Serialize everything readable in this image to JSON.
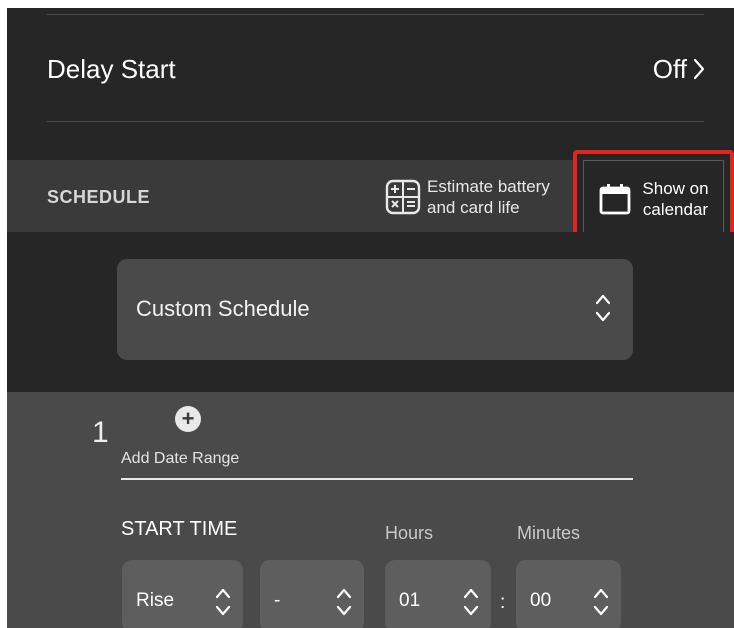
{
  "delay_start": {
    "label": "Delay Start",
    "value": "Off"
  },
  "schedule": {
    "section_title": "SCHEDULE",
    "estimate_label": "Estimate battery\nand card life",
    "calendar_label": "Show on\ncalendar",
    "dropdown_value": "Custom Schedule"
  },
  "range": {
    "number": "1",
    "add_icon_glyph": "+",
    "add_label": "Add Date Range",
    "start_time_label": "START TIME",
    "hours_label": "Hours",
    "minutes_label": "Minutes",
    "mode_value": "Rise",
    "offset_value": "-",
    "hours_value": "01",
    "separator": ":",
    "minutes_value": "00"
  },
  "icons": {
    "delay_chevron": "chevron-right-icon",
    "estimate": "calculator-icon",
    "calendar": "calendar-icon",
    "dropdown_chevron": "up-down-chevron-icon",
    "add": "plus-circle-icon"
  },
  "colors": {
    "highlight_border": "#e5231d",
    "background": "#262626",
    "panel": "#4a4a4a"
  }
}
